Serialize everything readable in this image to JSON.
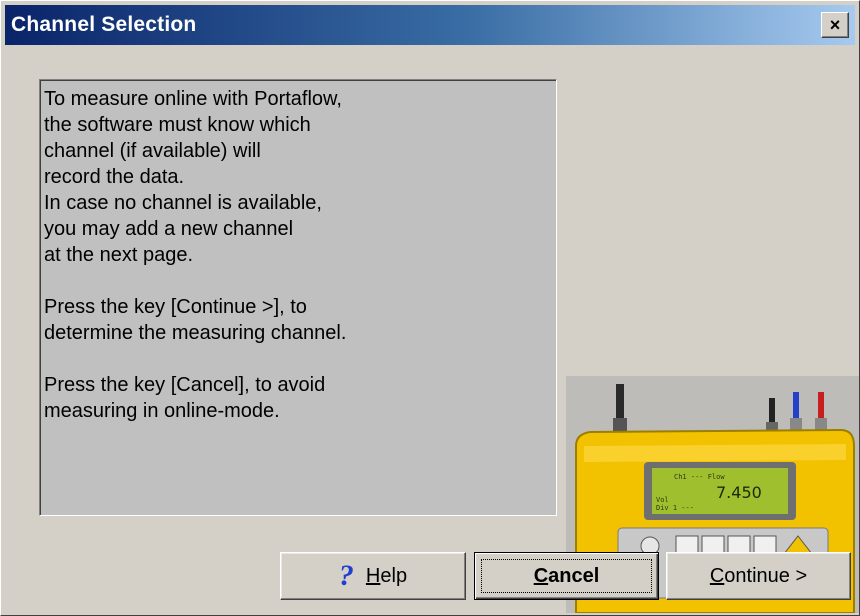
{
  "window": {
    "title": "Channel Selection",
    "close_label": "×"
  },
  "info": {
    "lines": [
      "To measure online with Portaflow,",
      "the software must know which",
      "channel (if available) will",
      "record the data.",
      "In case no channel is available,",
      "you may add a new channel",
      "at the next page.",
      "",
      "Press the key [Continue >], to",
      "determine the measuring channel.",
      "",
      "Press the key [Cancel], to avoid",
      "measuring in online-mode."
    ]
  },
  "device": {
    "display_value": "7.450"
  },
  "buttons": {
    "help": {
      "icon": "?",
      "mnemonic": "H",
      "rest": "elp"
    },
    "cancel": {
      "mnemonic": "C",
      "rest": "ancel"
    },
    "continue": {
      "mnemonic": "C",
      "rest": "ontinue >"
    }
  },
  "colors": {
    "title_start": "#0a246a",
    "title_end": "#a6caf0",
    "device_body": "#f2c200",
    "lcd": "#9fbf2f"
  }
}
